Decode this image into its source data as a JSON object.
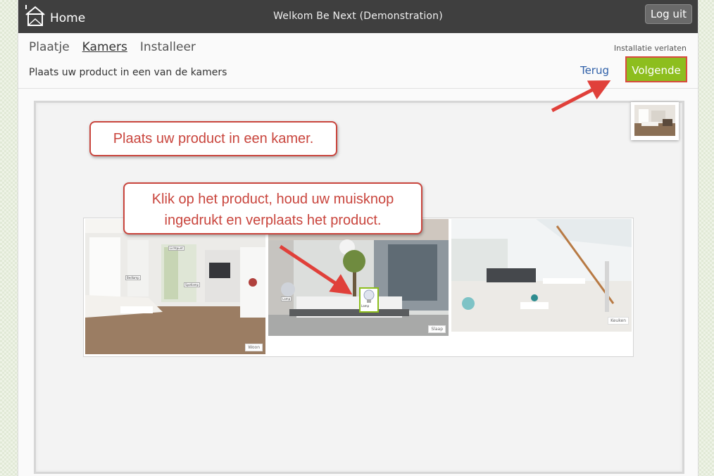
{
  "topbar": {
    "home_label": "Home",
    "welcome": "Welkom Be Next (Demonstration)",
    "logout": "Log uit"
  },
  "steps": [
    {
      "label": "Plaatje",
      "active": false
    },
    {
      "label": "Kamers",
      "active": true
    },
    {
      "label": "Installeer",
      "active": false
    }
  ],
  "instruction": "Plaats uw product in een van de kamers",
  "actions": {
    "leave": "Installatie verlaten",
    "back": "Terug",
    "next": "Volgende"
  },
  "callouts": {
    "first": "Plaats uw product in een kamer.",
    "second_line1": "Klik op het product, houd uw muisknop",
    "second_line2": "ingedrukt en verplaats het product."
  },
  "rooms": [
    {
      "label": "Woon",
      "tags": [
        "Lichtpunt",
        "Bedlamp",
        "Spotlamp"
      ]
    },
    {
      "label": "Slaap",
      "tags": [
        "Lamp",
        "Lamp"
      ]
    },
    {
      "label": "Keuken",
      "tags": []
    }
  ],
  "colors": {
    "accent_green": "#8dbe1e",
    "annotation_red": "#c9453d",
    "topbar": "#3f3f3f",
    "link_blue": "#2e5fa8"
  }
}
